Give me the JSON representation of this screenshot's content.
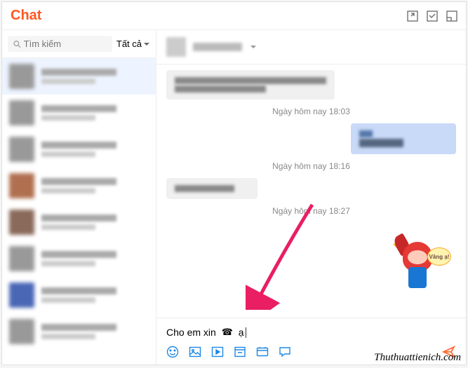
{
  "header": {
    "title": "Chat"
  },
  "sidebar": {
    "search_placeholder": "Tìm kiếm",
    "filter_label": "Tất cả"
  },
  "timestamps": {
    "t1": "Ngày hôm nay 18:03",
    "t2": "Ngày hôm nay 18:16",
    "t3": "Ngày hôm nay 18:27"
  },
  "input": {
    "text_part1": "Cho em xin",
    "text_part2": "ạ"
  },
  "sticker": {
    "bubble_text": "Vâng ạ!"
  },
  "watermark": "Thuthuattienich.com"
}
